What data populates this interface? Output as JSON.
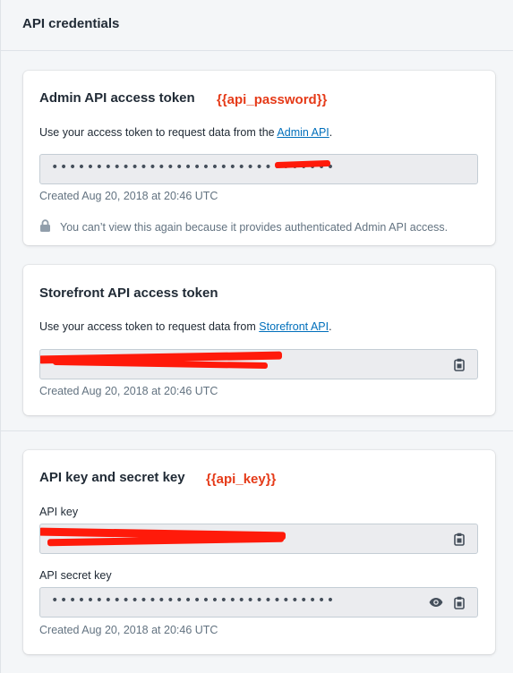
{
  "page": {
    "title": "API credentials"
  },
  "admin": {
    "title": "Admin API access token",
    "placeholder_tag": "{{api_password}}",
    "desc_prefix": "Use your access token to request data from the ",
    "desc_link": "Admin API",
    "desc_suffix": ".",
    "token_mask": "••••••••••••••••••••••••••••••••",
    "created": "Created Aug 20, 2018 at 20:46 UTC",
    "lock_note": "You can’t view this again because it provides authenticated Admin API access."
  },
  "storefront": {
    "title": "Storefront API access token",
    "desc_prefix": "Use your access token to request data from ",
    "desc_link": "Storefront API",
    "desc_suffix": ".",
    "created": "Created Aug 20, 2018 at 20:46 UTC"
  },
  "keys": {
    "title": "API key and secret key",
    "placeholder_tag": "{{api_key}}",
    "api_key_label": "API key",
    "api_secret_label": "API secret key",
    "secret_mask": "••••••••••••••••••••••••••••••••",
    "created": "Created Aug 20, 2018 at 20:46 UTC"
  },
  "icons": {
    "copy": "clipboard-icon",
    "reveal": "eye-icon",
    "lock": "lock-icon"
  },
  "colors": {
    "accent_link": "#006fbb",
    "annotation_red": "#e53a18",
    "redaction": "#ff1a0a"
  }
}
